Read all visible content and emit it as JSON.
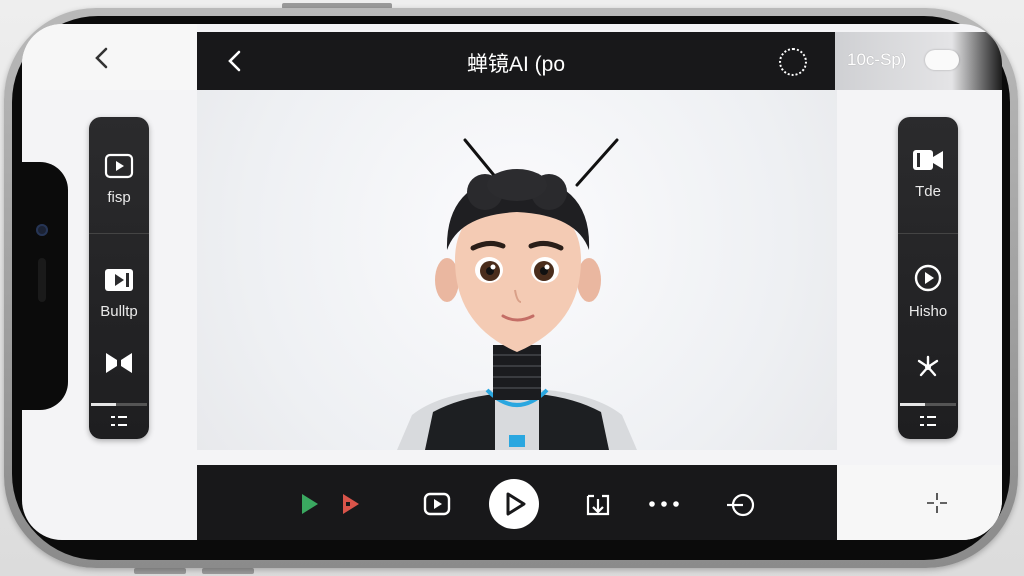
{
  "top_bar": {
    "title": "蝉镜AI (po",
    "status_text": "10c-Sp)"
  },
  "left_panel": {
    "items": [
      {
        "label": "fisp",
        "icon": "play-square-icon"
      },
      {
        "label": "Bulltp",
        "icon": "play-filled-square-icon"
      },
      {
        "label": "",
        "icon": "bowtie-icon"
      }
    ],
    "progress": 0.45,
    "menu_icon": "list-icon"
  },
  "right_panel": {
    "items": [
      {
        "label": "Tde",
        "icon": "video-camera-icon"
      },
      {
        "label": "Hisho",
        "icon": "play-circle-icon"
      },
      {
        "label": "",
        "icon": "fan-icon"
      }
    ],
    "progress": 0.45,
    "menu_icon": "list-icon"
  },
  "bottom_bar": {
    "icons": [
      "play-green-icon",
      "play-red-icon",
      "play-square-icon",
      "play-main-icon",
      "upload-frame-icon",
      "more-icon",
      "circle-arrow-icon"
    ]
  },
  "colors": {
    "bar_bg": "#18181a",
    "panel_bg": "#2b2b2d",
    "accent_green": "#3aa860",
    "accent_red": "#d9544a",
    "suit_blue": "#2aa7e0"
  }
}
